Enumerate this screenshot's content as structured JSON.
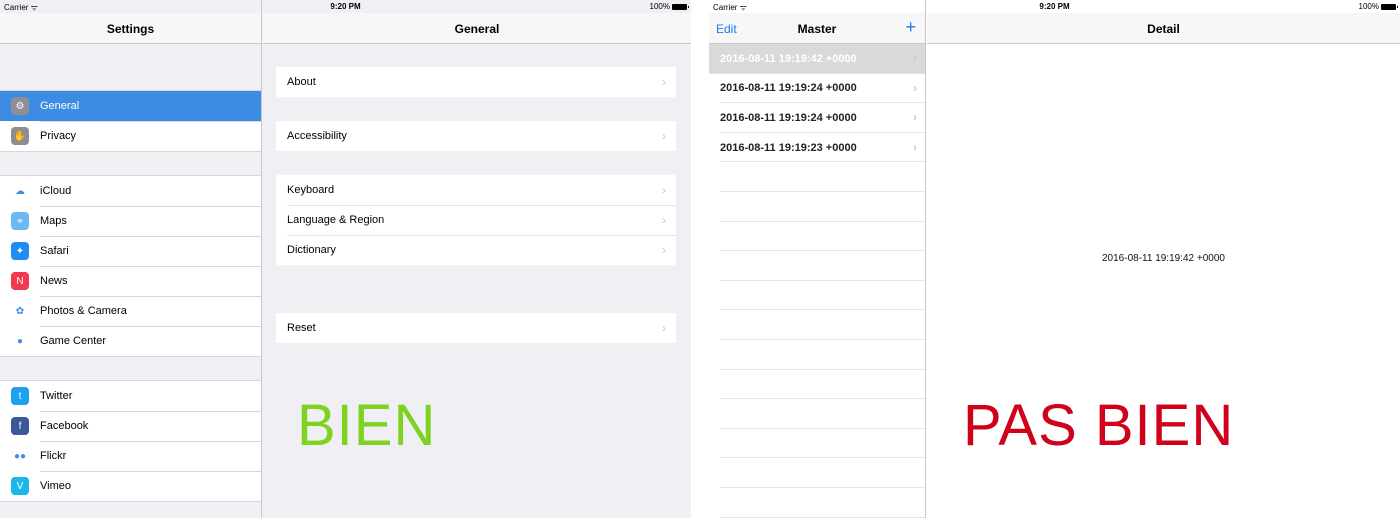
{
  "left": {
    "status": {
      "carrier": "Carrier ᯤ",
      "time": "9:20 PM",
      "battery": "100%"
    },
    "settings_title": "Settings",
    "general_title": "General",
    "settings_groups": [
      [
        {
          "label": "General",
          "icon": "gear-icon",
          "color": "#8e8e93",
          "glyph": "⚙",
          "selected": true
        },
        {
          "label": "Privacy",
          "icon": "hand-icon",
          "color": "#8e8e93",
          "glyph": "✋"
        }
      ],
      [
        {
          "label": "iCloud",
          "icon": "cloud-icon",
          "color": "#ffffff",
          "glyph": "☁"
        },
        {
          "label": "Maps",
          "icon": "maps-icon",
          "color": "#6cb9ef",
          "glyph": "⌖"
        },
        {
          "label": "Safari",
          "icon": "compass-icon",
          "color": "#1e8df2",
          "glyph": "✦"
        },
        {
          "label": "News",
          "icon": "news-icon",
          "color": "#f0384f",
          "glyph": "N"
        },
        {
          "label": "Photos & Camera",
          "icon": "photos-icon",
          "color": "#ffffff",
          "glyph": "✿"
        },
        {
          "label": "Game Center",
          "icon": "game-center-icon",
          "color": "#ffffff",
          "glyph": "●"
        }
      ],
      [
        {
          "label": "Twitter",
          "icon": "twitter-icon",
          "color": "#1da1f2",
          "glyph": "t"
        },
        {
          "label": "Facebook",
          "icon": "facebook-icon",
          "color": "#3b5998",
          "glyph": "f"
        },
        {
          "label": "Flickr",
          "icon": "flickr-icon",
          "color": "#ffffff",
          "glyph": "●●"
        },
        {
          "label": "Vimeo",
          "icon": "vimeo-icon",
          "color": "#1ab7ea",
          "glyph": "V"
        }
      ]
    ],
    "general_groups": [
      [
        "About"
      ],
      [
        "Accessibility"
      ],
      [
        "Keyboard",
        "Language & Region",
        "Dictionary"
      ],
      [
        "Reset"
      ]
    ],
    "caption": "BIEN",
    "caption_color": "#7ed321"
  },
  "right": {
    "status": {
      "carrier": "Carrier ᯤ",
      "time": "9:20 PM",
      "battery": "100%"
    },
    "master_title": "Master",
    "edit_label": "Edit",
    "add_label": "+",
    "detail_title": "Detail",
    "rows": [
      {
        "label": "2016-08-11 19:19:42 +0000",
        "selected": true
      },
      {
        "label": "2016-08-11 19:19:24 +0000"
      },
      {
        "label": "2016-08-11 19:19:24 +0000"
      },
      {
        "label": "2016-08-11 19:19:23 +0000"
      }
    ],
    "detail_text": "2016-08-11 19:19:42 +0000",
    "caption": "PAS BIEN",
    "caption_color": "#d0021b"
  }
}
